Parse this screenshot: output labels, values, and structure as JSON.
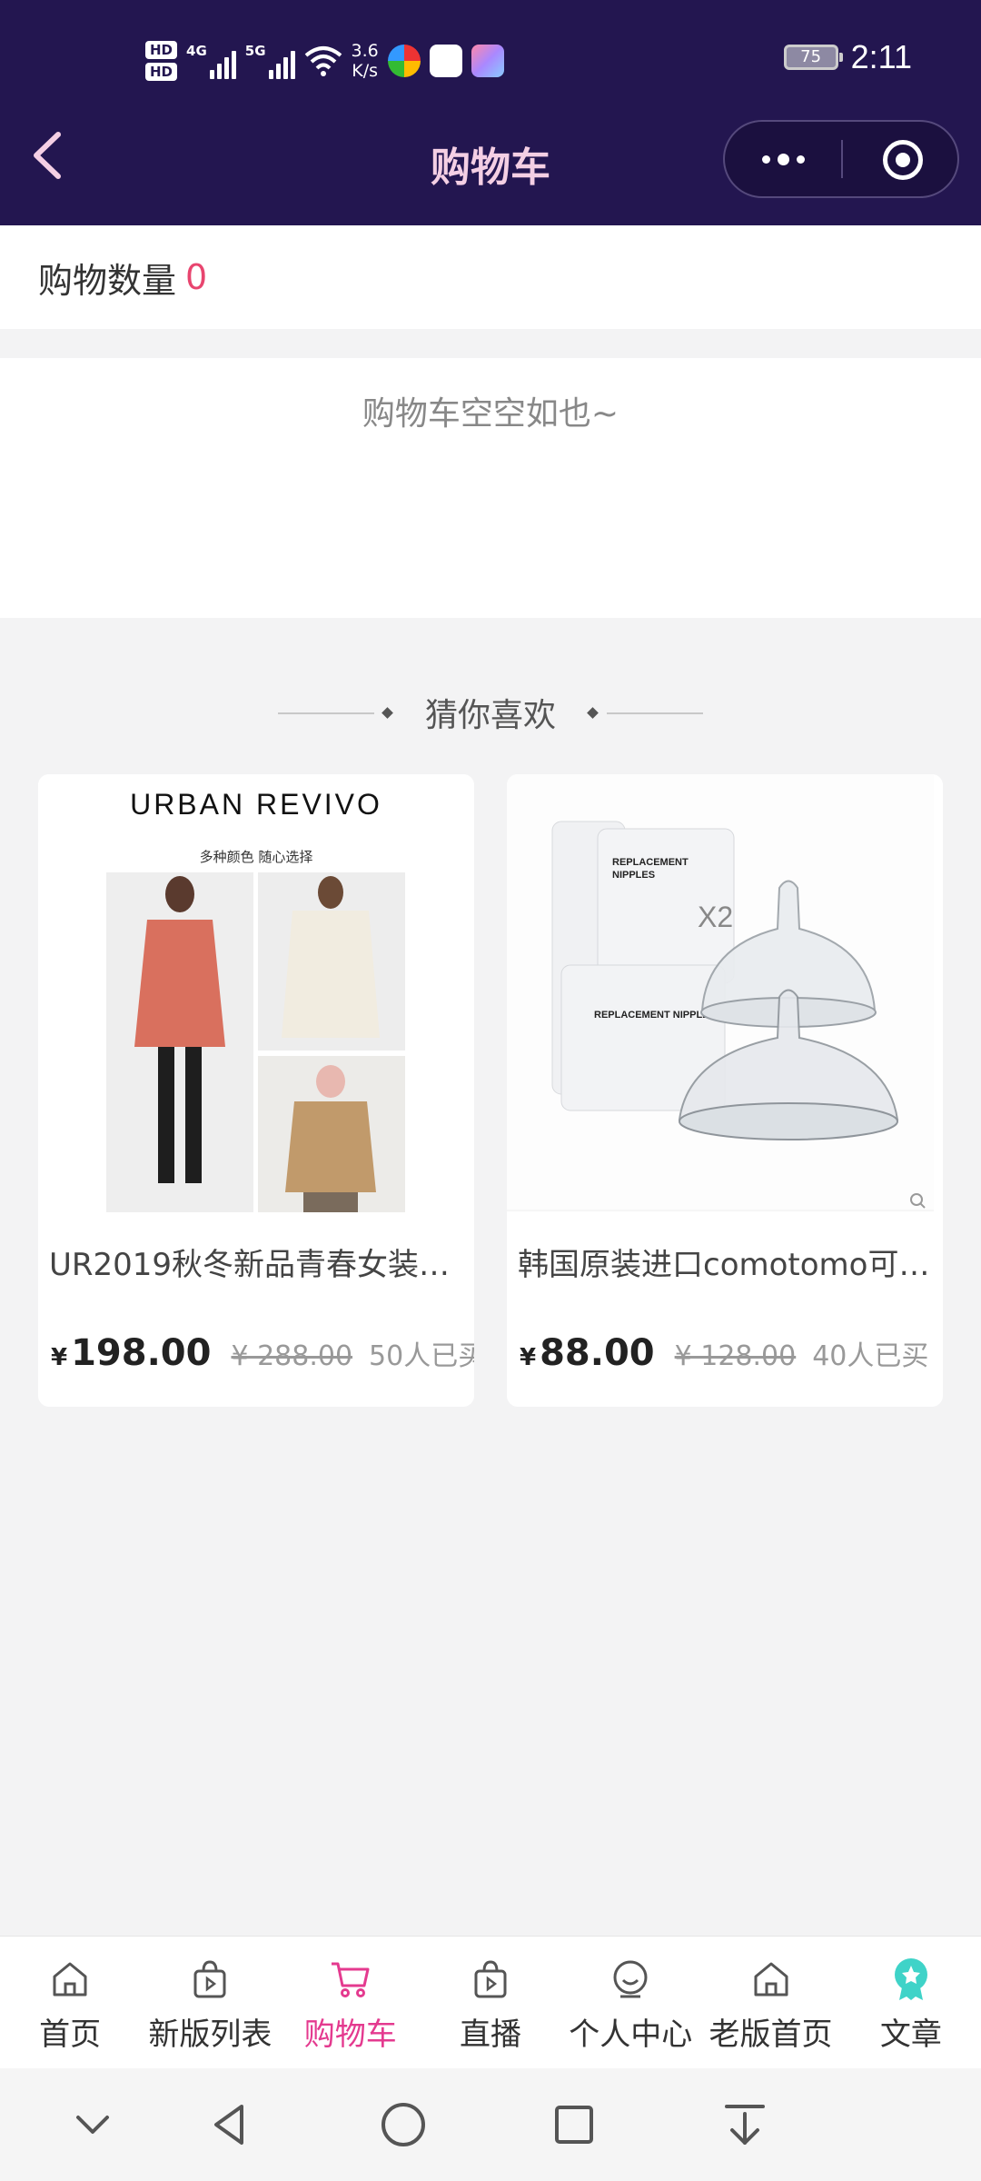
{
  "status_bar": {
    "hd1": "HD",
    "hd2": "HD",
    "net1": "4G",
    "net2": "5G",
    "speed_value": "3.6",
    "speed_unit": "K/s",
    "battery": "75",
    "time": "2:11"
  },
  "header": {
    "title": "购物车"
  },
  "cart": {
    "count_label": "购物数量",
    "count_value": "0",
    "empty_text": "购物车空空如也~"
  },
  "recommend": {
    "title": "猜你喜欢",
    "products": [
      {
        "name": "UR2019秋冬新品青春女装时…",
        "currency": "¥",
        "price": "198.00",
        "original_price": "¥ 288.00",
        "sold": "50人已买",
        "image_brand": "URBAN REVIVO",
        "image_caption": "多种颜色 随心选择"
      },
      {
        "name": "韩国原装进口comotomo可…",
        "currency": "¥",
        "price": "88.00",
        "original_price": "¥ 128.00",
        "sold": "40人已买",
        "image_text": "REPLACEMENT NIPPLES",
        "image_badge": "X2"
      }
    ]
  },
  "tabbar": {
    "items": [
      {
        "label": "首页",
        "icon": "home-icon"
      },
      {
        "label": "新版列表",
        "icon": "bag-play-icon"
      },
      {
        "label": "购物车",
        "icon": "cart-icon",
        "active": true
      },
      {
        "label": "直播",
        "icon": "bag-play-icon"
      },
      {
        "label": "个人中心",
        "icon": "face-icon"
      },
      {
        "label": "老版首页",
        "icon": "home-icon"
      },
      {
        "label": "文章",
        "icon": "badge-star-icon"
      }
    ]
  },
  "colors": {
    "header_bg": "#231650",
    "accent": "#e43a8f",
    "count_color": "#e8456f"
  }
}
